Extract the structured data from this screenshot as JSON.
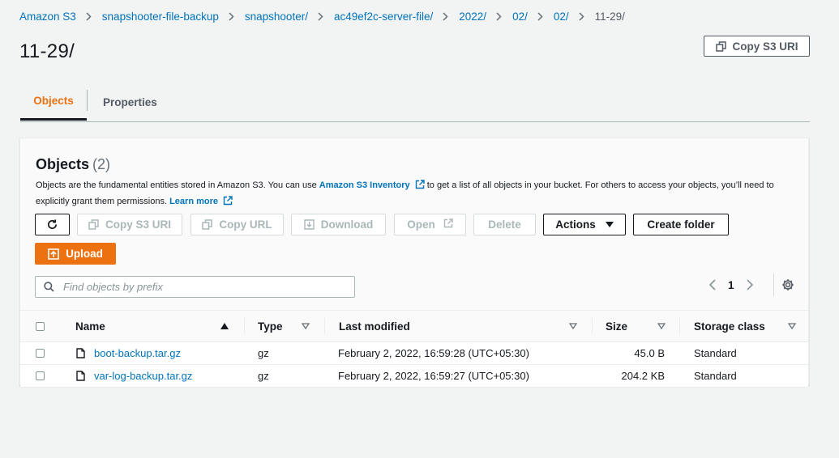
{
  "breadcrumb": [
    "Amazon S3",
    "snapshooter-file-backup",
    "snapshooter/",
    "ac49ef2c-server-file/",
    "2022/",
    "02/",
    "02/",
    "11-29/"
  ],
  "page_title": "11-29/",
  "copy_s3_uri_label": "Copy S3 URI",
  "tabs": [
    {
      "label": "Objects",
      "active": true
    },
    {
      "label": "Properties",
      "active": false
    }
  ],
  "panel": {
    "title": "Objects",
    "count": "(2)",
    "desc_part1": "Objects are the fundamental entities stored in Amazon S3. You can use",
    "inventory_link": "Amazon S3 Inventory",
    "desc_part2": "to get a list of all objects in your bucket. For others to access your objects, you’ll need to explicitly grant them permissions.",
    "learn_more": "Learn more"
  },
  "toolbar": {
    "refresh_icon": "refresh-icon",
    "copy_s3_uri": "Copy S3 URI",
    "copy_url": "Copy URL",
    "download": "Download",
    "open": "Open",
    "delete": "Delete",
    "actions": "Actions",
    "create_folder": "Create folder",
    "upload": "Upload"
  },
  "search": {
    "placeholder": "Find objects by prefix",
    "value": ""
  },
  "pagination": {
    "page": "1"
  },
  "table": {
    "columns": [
      "Name",
      "Type",
      "Last modified",
      "Size",
      "Storage class"
    ],
    "rows": [
      {
        "name": "boot-backup.tar.gz",
        "type": "gz",
        "last_modified": "February 2, 2022, 16:59:28 (UTC+05:30)",
        "size": "45.0 B",
        "storage_class": "Standard"
      },
      {
        "name": "var-log-backup.tar.gz",
        "type": "gz",
        "last_modified": "February 2, 2022, 16:59:27 (UTC+05:30)",
        "size": "204.2 KB",
        "storage_class": "Standard"
      }
    ]
  },
  "colors": {
    "accent": "#ec7211",
    "link": "#0073bb",
    "text": "#16191f",
    "muted": "#545b64",
    "background": "#f2f3f3"
  }
}
